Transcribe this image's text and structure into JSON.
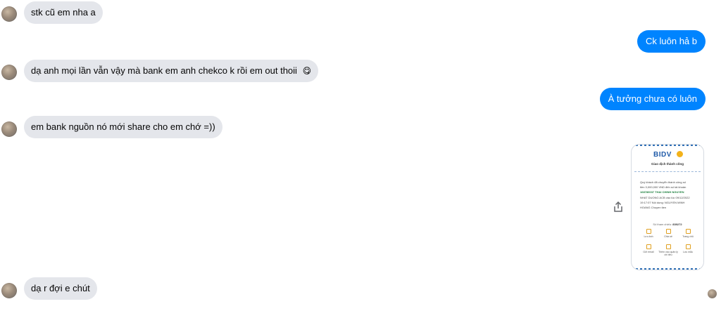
{
  "messages": [
    {
      "id": "m1",
      "side": "in",
      "text": "stk cũ em nha a"
    },
    {
      "id": "m2",
      "side": "out",
      "text": "Ck luôn hả b"
    },
    {
      "id": "m3",
      "side": "in",
      "text": "dạ anh mọi lần vẫn vậy mà bank em anh chekco k rồi em out thoii",
      "emoji": "😋"
    },
    {
      "id": "m4",
      "side": "out",
      "text": "À tưởng chưa có luôn"
    },
    {
      "id": "m5",
      "side": "in",
      "text": "em bank nguồn nó mới share cho em chớ =))"
    },
    {
      "id": "m7",
      "side": "in",
      "text": "dạ r đợi e chút"
    }
  ],
  "receipt": {
    "logo": "BIDV",
    "status": "Giao dịch thành công",
    "body_lines": [
      "Quý khách đã chuyển thành công số",
      "tiền 3,000,000 VND đến số tài khoản",
      "168780037 THAI CHINH NGUYEN",
      "NHAT DUONG ACB vào lúc 09/12/2022",
      "19:17:07 Nội dung: NGUYEN MINH",
      "HOANG Chuyen tien"
    ],
    "ref_label": "Số tham chiếu:",
    "ref_value": "839272",
    "actions": [
      "Lưu ảnh",
      "Chia sẻ",
      "Trang chủ",
      "Gửi email",
      "Thêm vào quản lý chi tiêu",
      "Lưu mẫu"
    ]
  },
  "icons": {
    "share": "share-icon",
    "avatar": "contact-avatar",
    "seen": "seen-avatar"
  },
  "colors": {
    "outgoing_bubble": "#0084ff",
    "incoming_bubble": "#e4e6eb"
  }
}
